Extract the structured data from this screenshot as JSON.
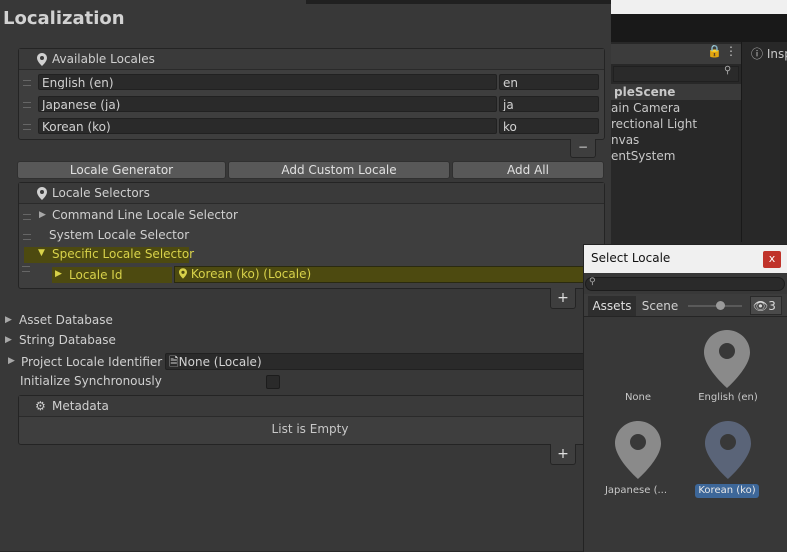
{
  "title": "Localization",
  "background": {
    "hierarchy": {
      "items": [
        "pleScene",
        "ain Camera",
        "rectional Light",
        "nvas",
        "entSystem"
      ]
    },
    "inspector_tab": "Insp",
    "hidden_count": "3"
  },
  "available_locales": {
    "header": "Available Locales",
    "rows": [
      {
        "name": "English (en)",
        "code": "en"
      },
      {
        "name": "Japanese (ja)",
        "code": "ja"
      },
      {
        "name": "Korean (ko)",
        "code": "ko"
      }
    ],
    "remove_label": "−"
  },
  "buttons": {
    "generator": "Locale Generator",
    "add_custom": "Add Custom Locale",
    "add_all": "Add All"
  },
  "locale_selectors": {
    "header": "Locale Selectors",
    "items": [
      "Command Line Locale Selector",
      "System Locale Selector",
      "Specific Locale Selector"
    ],
    "locale_id_label": "Locale Id",
    "locale_id_value": "Korean (ko) (Locale)",
    "add_label": "+"
  },
  "settings": {
    "asset_database": "Asset Database",
    "string_database": "String Database",
    "project_locale_label": "Project Locale Identifier",
    "project_locale_value": "None (Locale)",
    "init_sync_label": "Initialize Synchronously"
  },
  "metadata": {
    "header": "Metadata",
    "empty": "List is Empty",
    "add_label": "+"
  },
  "popup": {
    "title": "Select Locale",
    "close": "x",
    "tab_assets": "Assets",
    "tab_scene": "Scene",
    "items": [
      "None",
      "English (en)",
      "Japanese (...",
      "Korean (ko)"
    ],
    "selected": "Korean (ko)"
  },
  "colors": {
    "highlight": "#4d4a10",
    "highlight_text": "#d8d24a",
    "selection": "#3d6799",
    "close": "#c0332a"
  }
}
